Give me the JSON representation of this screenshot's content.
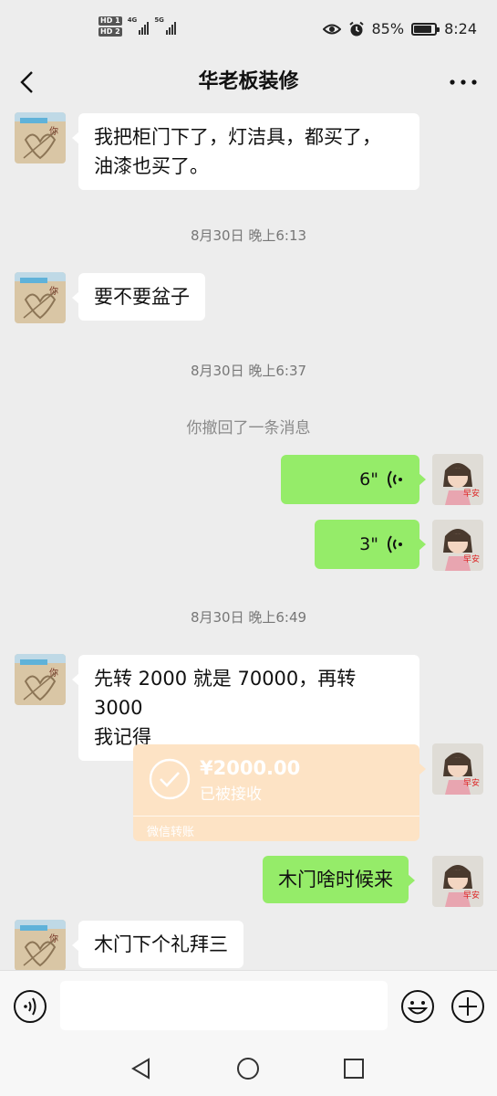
{
  "status_bar": {
    "hd1": "HD 1",
    "hd2": "HD 2",
    "net1": "4G",
    "net2": "5G",
    "battery_percent": "85%",
    "battery_level": 0.85,
    "time": "8:24"
  },
  "nav": {
    "title": "华老板装修",
    "back_icon": "chevron-left-icon",
    "more_icon": "more-dots-icon"
  },
  "messages": {
    "m1": "我把柜门下了，灯洁具，都买了，\n油漆也买了。",
    "t1": "8月30日 晚上6:13",
    "m2": "要不要盆子",
    "t2": "8月30日 晚上6:37",
    "recall": "你撤回了一条消息",
    "v1": "6\"",
    "v2": "3\"",
    "t3": "8月30日 晚上6:49",
    "m3": "先转 2000 就是 70000，再转 3000\n我记得",
    "transfer": {
      "amount": "¥2000.00",
      "status": "已被接收",
      "footer": "微信转账"
    },
    "m4": "木门啥时候来",
    "m5": "木门下个礼拜三"
  },
  "avatars": {
    "other_text": "你",
    "self_text": "早安"
  },
  "input_bar": {
    "voice_icon": "voice-mode-icon",
    "emoji_icon": "emoji-icon",
    "plus_icon": "plus-icon"
  },
  "colors": {
    "bg": "#ededed",
    "bubble_self": "#95ec69",
    "bubble_other": "#ffffff",
    "transfer": "#fde3c5"
  }
}
